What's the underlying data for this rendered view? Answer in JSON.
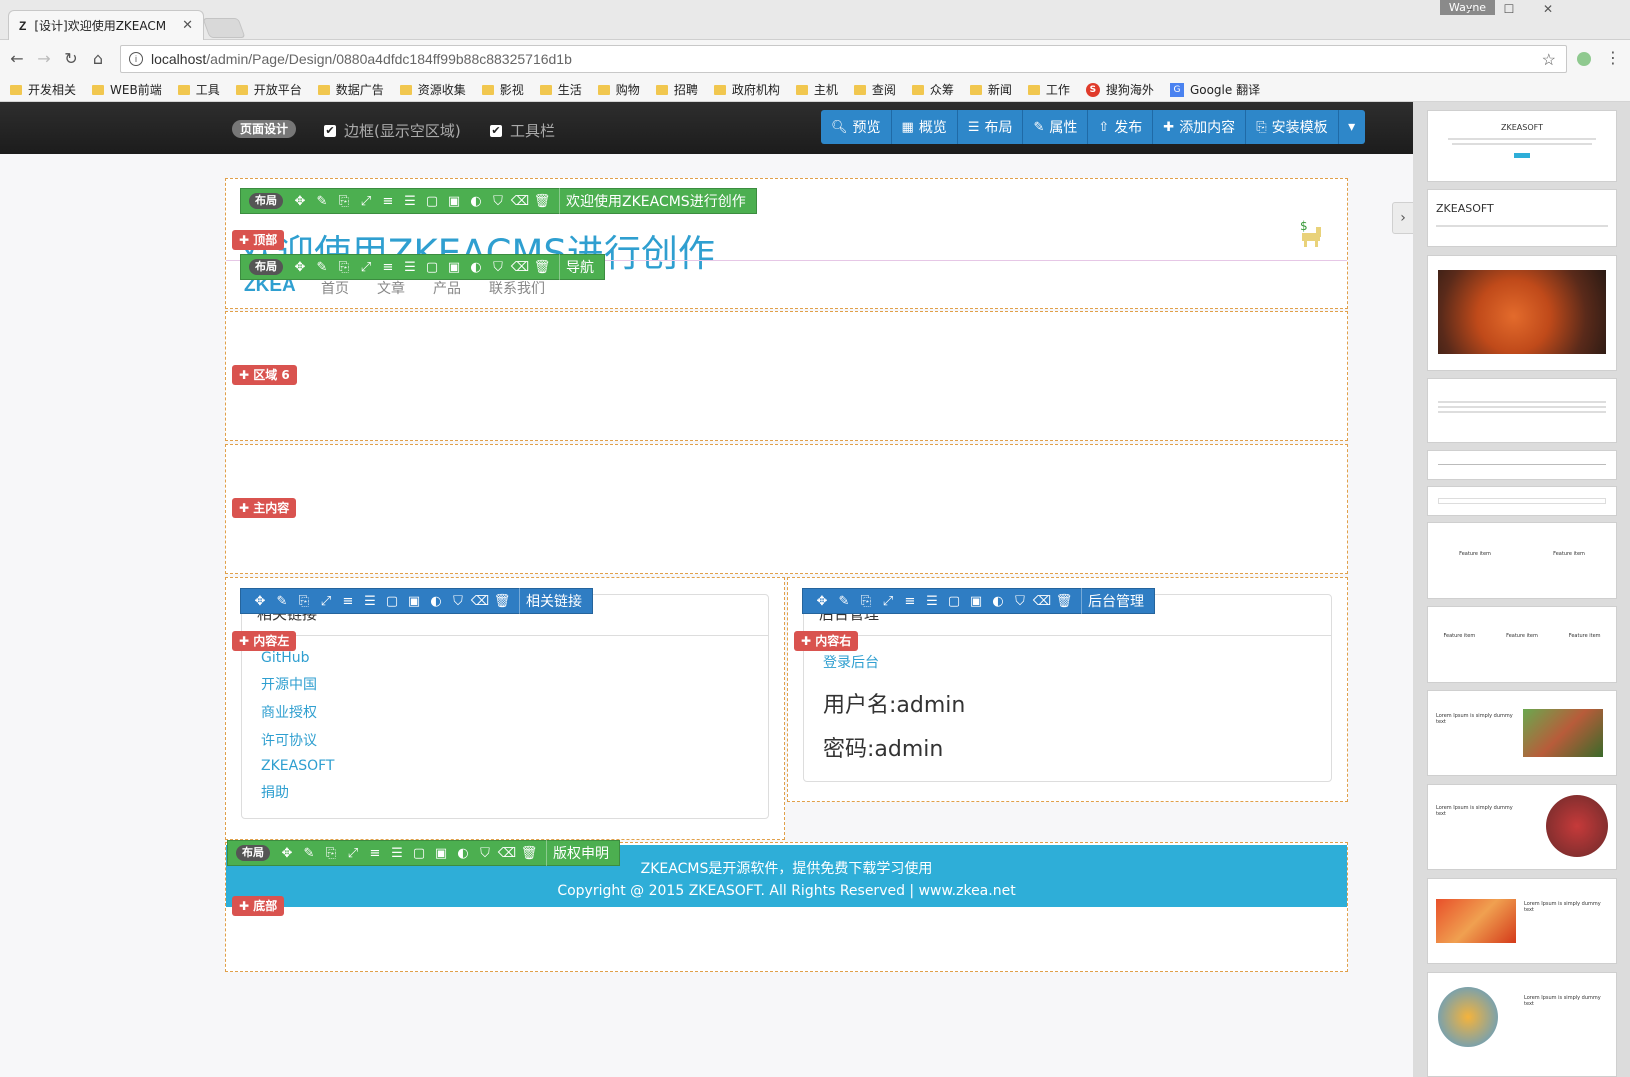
{
  "browser": {
    "tab_title": "[设计]欢迎使用ZKEACM",
    "tab_favicon": "Z",
    "user_label": "Wayne",
    "url_host": "localhost",
    "url_path": "/admin/Page/Design/0880a4dfdc184ff99b88c88325716d1b",
    "bookmarks": [
      "开发相关",
      "WEB前端",
      "工具",
      "开放平台",
      "数据广告",
      "资源收集",
      "影视",
      "生活",
      "购物",
      "招聘",
      "政府机构",
      "主机",
      "查阅",
      "众筹",
      "新闻",
      "工作",
      "搜狗海外",
      "Google 翻译"
    ]
  },
  "designbar": {
    "badge": "页面设计",
    "check_border": "边框(显示空区域)",
    "check_toolbar": "工具栏",
    "buttons": [
      "预览",
      "概览",
      "布局",
      "属性",
      "发布",
      "添加内容",
      "安装模板"
    ]
  },
  "zones": {
    "top": "顶部",
    "area6": "区域 6",
    "main": "主内容",
    "left": "内容左",
    "right": "内容右",
    "bottom": "底部"
  },
  "widgets": {
    "layout_badge": "布局",
    "welcome_bar": "欢迎使用ZKEACMS进行创作",
    "nav_bar": "导航",
    "links_bar": "相关链接",
    "admin_bar": "后台管理",
    "copyright_bar": "版权申明"
  },
  "header": {
    "title": "欢迎使用ZKEACMS进行创作",
    "logo": "ZKEA",
    "nav": [
      "首页",
      "文章",
      "产品",
      "联系我们"
    ]
  },
  "links_panel": {
    "heading": "相关链接",
    "items": [
      "GitHub",
      "开源中国",
      "商业授权",
      "许可协议",
      "ZKEASOFT",
      "捐助"
    ]
  },
  "admin_panel": {
    "heading": "后台管理",
    "login": "登录后台",
    "username": "用户名:admin",
    "password": "密码:admin"
  },
  "footer": {
    "line1": "ZKEACMS是开源软件，提供免费下载学习使用",
    "line2": "Copyright @ 2015 ZKEASOFT. All Rights Reserved | www.zkea.net"
  },
  "thumbnails": {
    "t1_title": "ZKEASOFT",
    "t2_title": "ZKEASOFT",
    "feature": "Feature item",
    "lorem": "Lorem Ipsum is simply dummy text"
  },
  "colors": {
    "accent_blue": "#2e87c9",
    "zone_tag_red": "#d9534f",
    "widget_green": "#4caf50",
    "widget_blue": "#2f7dc3",
    "footer_bg": "#2eaed8"
  }
}
